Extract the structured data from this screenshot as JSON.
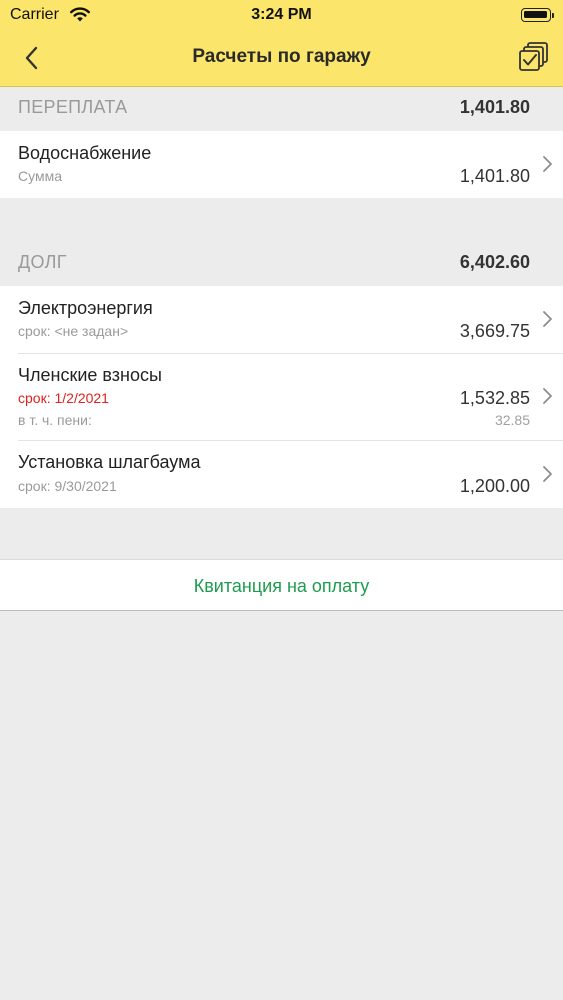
{
  "status_bar": {
    "carrier": "Carrier",
    "time": "3:24 PM"
  },
  "nav": {
    "title": "Расчеты по гаражу",
    "back_icon": "chevron-left-icon",
    "action_icon": "multi-select-checkbox-icon"
  },
  "overpayment": {
    "label": "ПЕРЕПЛАТА",
    "total": "1,401.80",
    "items": [
      {
        "name": "Водоснабжение",
        "sub": "Сумма",
        "value": "1,401.80"
      }
    ]
  },
  "debt": {
    "label": "ДОЛГ",
    "total": "6,402.60",
    "items": [
      {
        "name": "Электроэнергия",
        "sub": "срок: <не задан>",
        "value": "3,669.75"
      },
      {
        "name": "Членские взносы",
        "sub": "срок: 1/2/2021",
        "sub_color": "#e0211d",
        "sub2": "в т. ч. пени:",
        "value": "1,532.85",
        "value2": "32.85"
      },
      {
        "name": "Установка шлагбаума",
        "sub": "срок: 9/30/2021",
        "value": "1,200.00"
      }
    ]
  },
  "receipt_button": {
    "label": "Квитанция на оплату"
  },
  "colors": {
    "header": "#fbe56a",
    "accent_green": "#1d9c4f",
    "overdue_red": "#e0211d",
    "background": "#ececec"
  }
}
